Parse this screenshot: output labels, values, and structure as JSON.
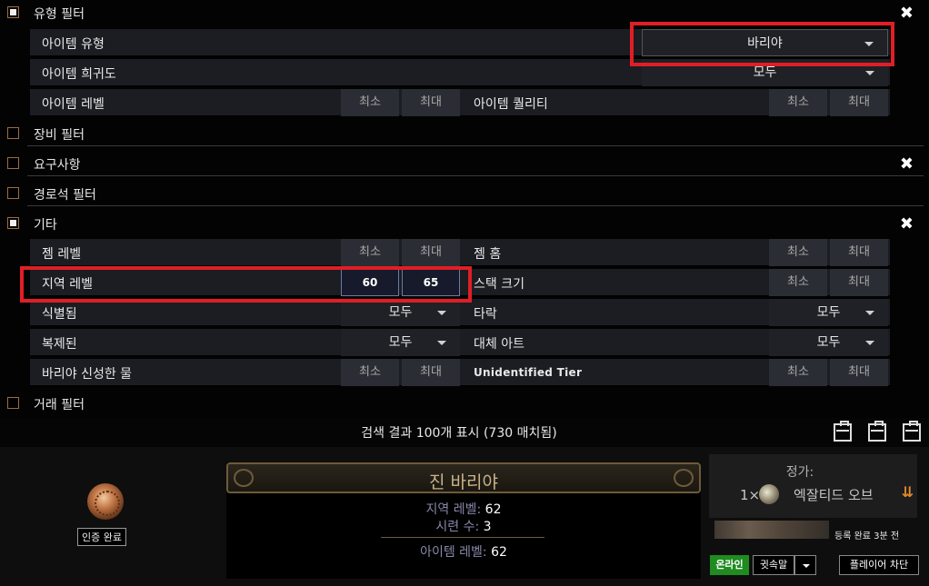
{
  "type_filters": {
    "title": "유형 필터",
    "item_type": {
      "label": "아이템 유형",
      "value": "바리야"
    },
    "rarity": {
      "label": "아이템 희귀도",
      "value": "모두"
    },
    "item_level": {
      "label": "아이템 레벨",
      "min": "최소",
      "max": "최대"
    },
    "quality": {
      "label": "아이템 퀄리티",
      "min": "최소",
      "max": "최대"
    }
  },
  "equipment_filters": {
    "title": "장비 필터"
  },
  "requirements": {
    "title": "요구사항"
  },
  "waystone_filters": {
    "title": "경로석 필터"
  },
  "misc": {
    "title": "기타",
    "gem_level": {
      "label": "젬 레벨",
      "min": "최소",
      "max": "최대"
    },
    "gem_sockets": {
      "label": "젬 홈",
      "min": "최소",
      "max": "최대"
    },
    "area_level": {
      "label": "지역 레벨",
      "min": "60",
      "max": "65"
    },
    "stack_size": {
      "label": "스택 크기",
      "min": "최소",
      "max": "최대"
    },
    "identified": {
      "label": "식별됨",
      "value": "모두"
    },
    "corrupted": {
      "label": "타락",
      "value": "모두"
    },
    "mirrored": {
      "label": "복제된",
      "value": "모두"
    },
    "alternate_art": {
      "label": "대체 아트",
      "value": "모두"
    },
    "barya_sacred_water": {
      "label": "바리야 신성한 물",
      "min": "최소",
      "max": "최대"
    },
    "unidentified_tier": {
      "label": "Unidentified Tier",
      "min": "최소",
      "max": "최대"
    }
  },
  "trade_filters": {
    "title": "거래 필터"
  },
  "results": {
    "summary": "검색 결과 100개 표시 (730 매치됨)"
  },
  "listing": {
    "verified": "인증 완료",
    "item_name": "진 바리야",
    "props": [
      {
        "label": "지역 레벨: ",
        "value": "62"
      },
      {
        "label": "시련 수: ",
        "value": "3"
      }
    ],
    "ilvl": {
      "label": "아이템 레벨: ",
      "value": "62"
    },
    "price_label": "정가:",
    "price_qty": "1×",
    "price_currency": "엑잘티드 오브",
    "listed": "등록 완료 3분 전",
    "online": "온라인",
    "whisper": "귓속말",
    "block": "플레이어 차단"
  },
  "colors": {
    "highlight": "#e01e26",
    "online": "#1f8b20",
    "item_name": "#c8b48a"
  }
}
